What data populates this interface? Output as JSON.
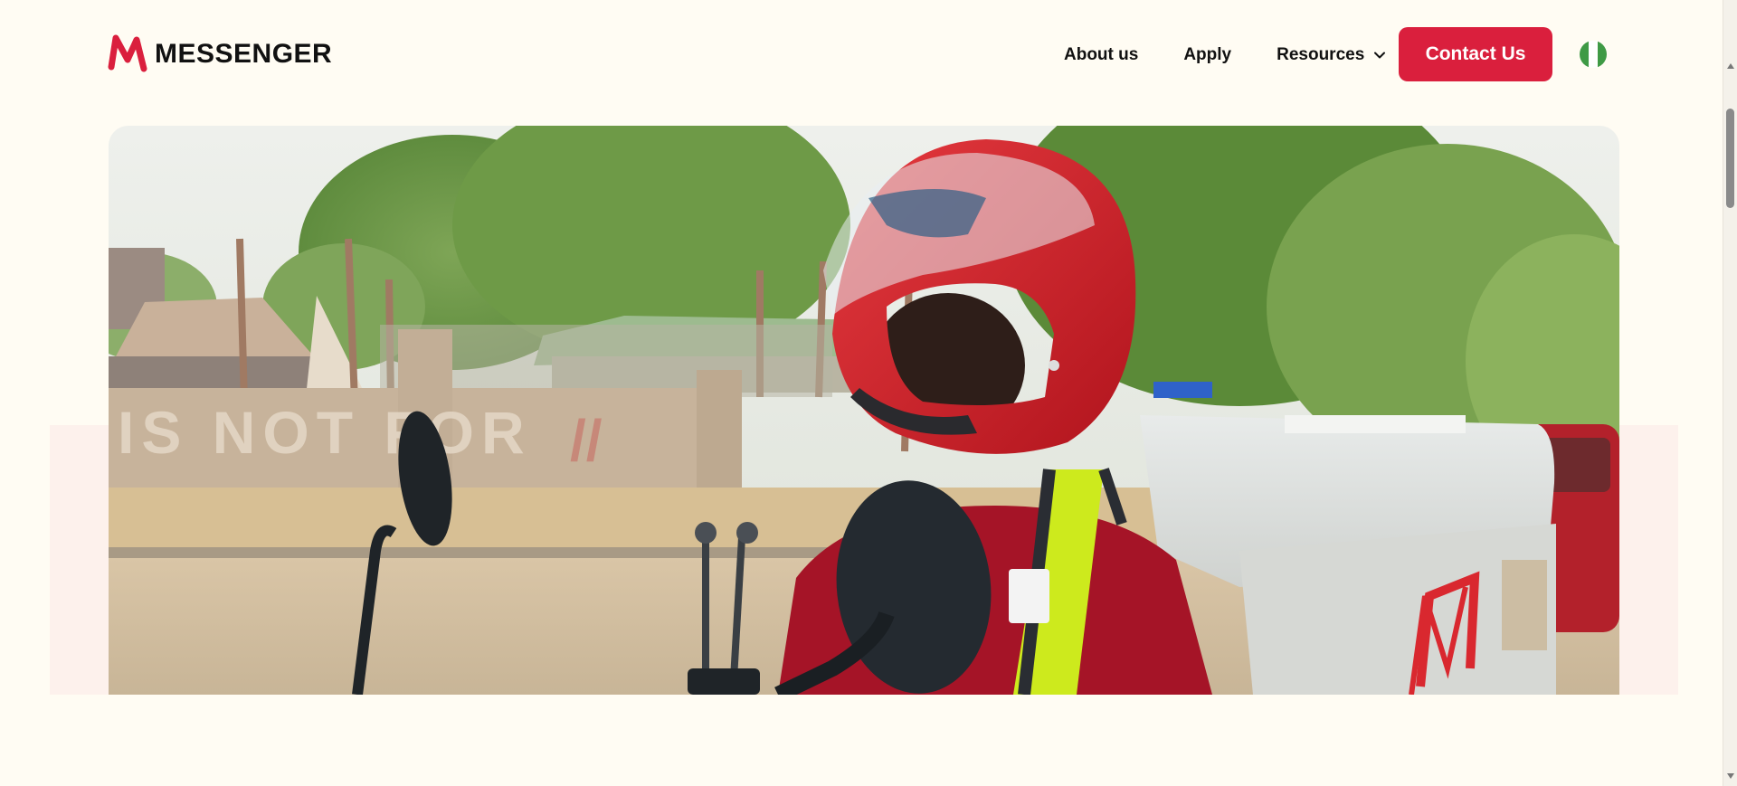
{
  "brand": {
    "name": "MESSENGER",
    "accent": "#da1f3d"
  },
  "nav": {
    "items": [
      {
        "label": "About us"
      },
      {
        "label": "Apply"
      },
      {
        "label": "Resources",
        "icon": "chevron-down-icon"
      }
    ],
    "contact_label": "Contact Us"
  },
  "locale": {
    "flag": "nigeria-flag",
    "colors": [
      "#3f9a45",
      "#ffffff",
      "#3f9a45"
    ]
  },
  "hero": {
    "image": "delivery-rider-in-red-helmet-on-motorcycle",
    "wall_text": "IS NOT FOR"
  }
}
